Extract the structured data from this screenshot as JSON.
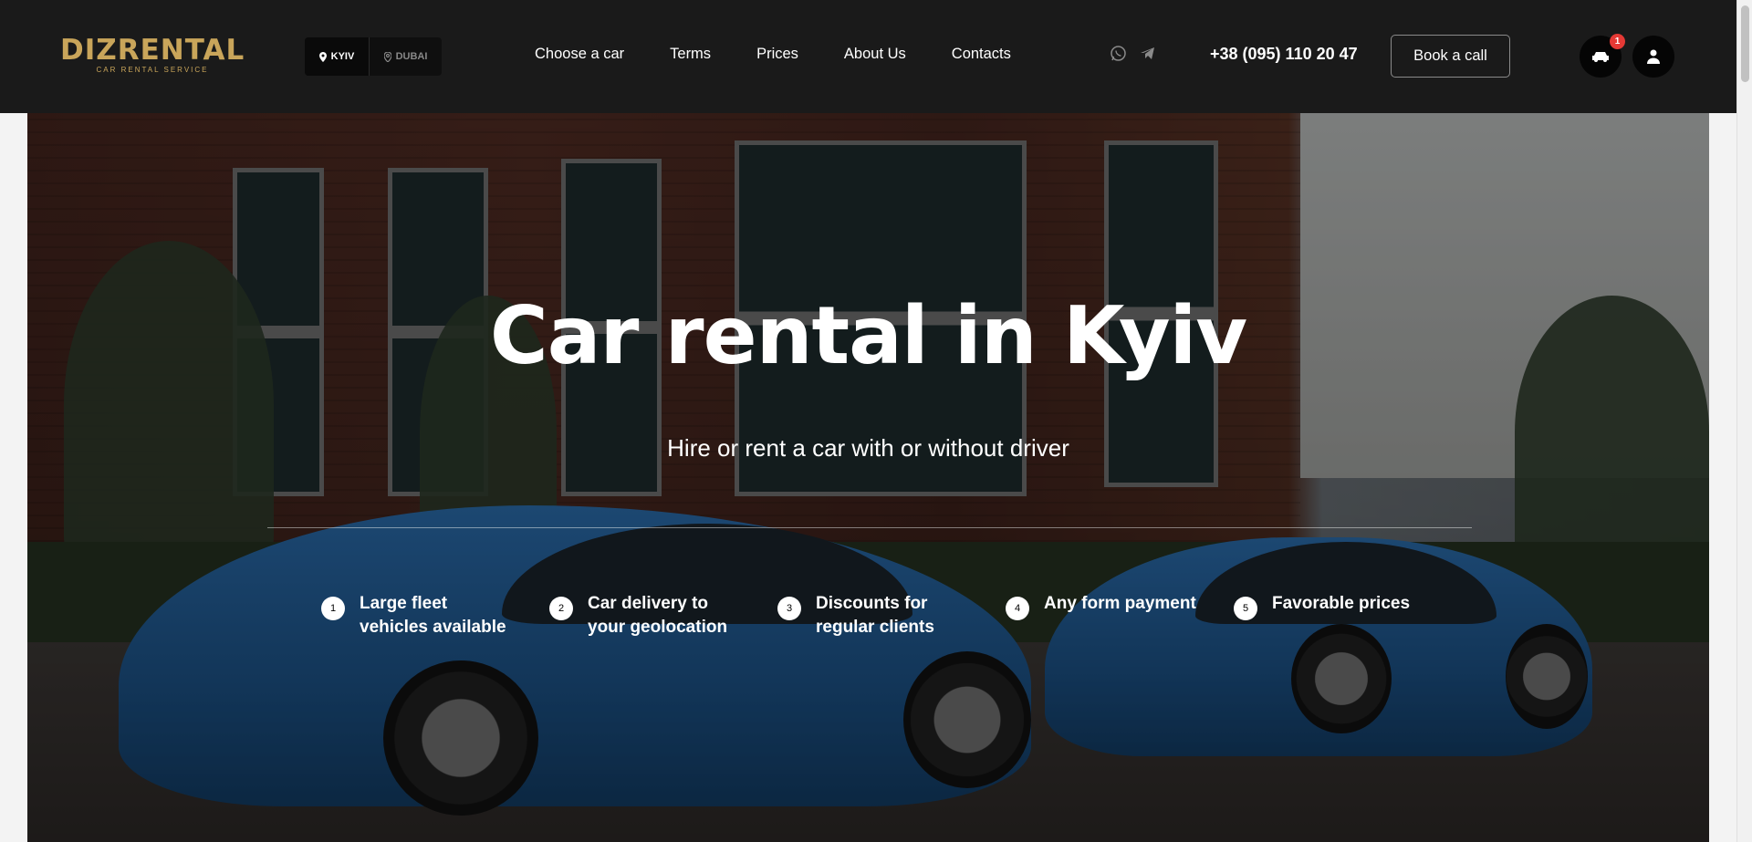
{
  "header": {
    "logo_text": "DIZRENTAL",
    "logo_subtitle": "CAR RENTAL SERVICE",
    "cities": [
      {
        "label": "KYIV",
        "active": true
      },
      {
        "label": "DUBAI",
        "active": false
      }
    ],
    "nav": [
      "Choose a car",
      "Terms",
      "Prices",
      "About Us",
      "Contacts"
    ],
    "messengers": [
      "whatsapp-icon",
      "telegram-icon"
    ],
    "phone": "+38 (095) 110 20 47",
    "book_call": "Book a call",
    "cart_count": "1"
  },
  "hero": {
    "title": "Car rental in Kyiv",
    "subtitle": "Hire or rent a car with or without driver",
    "features": [
      {
        "num": "1",
        "text": "Large fleet vehicles available"
      },
      {
        "num": "2",
        "text": "Car delivery to your geolocation"
      },
      {
        "num": "3",
        "text": "Discounts for regular clients"
      },
      {
        "num": "4",
        "text": "Any form payment"
      },
      {
        "num": "5",
        "text": "Favorable prices"
      }
    ]
  },
  "colors": {
    "header_bg": "#1a1a1a",
    "logo_gold": "#c9a55a",
    "badge_red": "#e53935",
    "page_bg": "#f3f3f3"
  }
}
